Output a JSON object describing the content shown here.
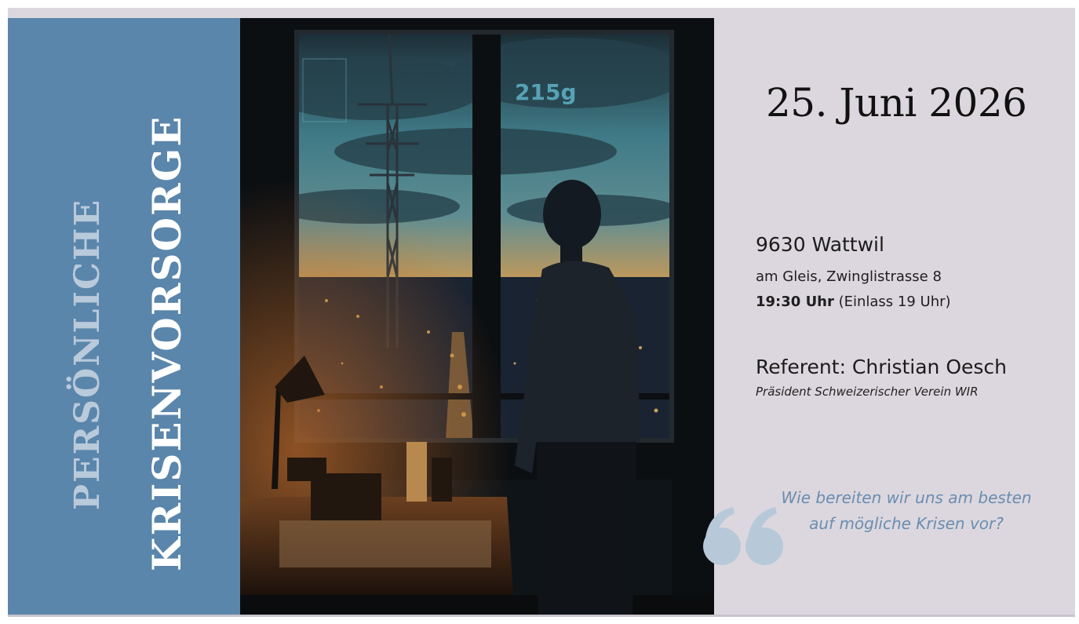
{
  "banner": {
    "title_line1": "PERSÖNLICHE",
    "title_line2": "KRISENVORSORGE",
    "bg_color": "#5b86ab"
  },
  "photo": {
    "overlay_text": "215g"
  },
  "event": {
    "date": "25. Juni 2026",
    "city": "9630 Wattwil",
    "address": "am Gleis, Zwinglistrasse 8",
    "time_bold": "19:30 Uhr",
    "time_note": " (Einlass 19 Uhr)"
  },
  "speaker": {
    "line": "Referent: Christian Oesch",
    "role": "Präsident Schweizerischer Verein WIR"
  },
  "quote": {
    "icon": "quote-icon",
    "text": "Wie bereiten wir uns am besten auf mögliche Krisen vor?",
    "color": "#6a8db0"
  }
}
